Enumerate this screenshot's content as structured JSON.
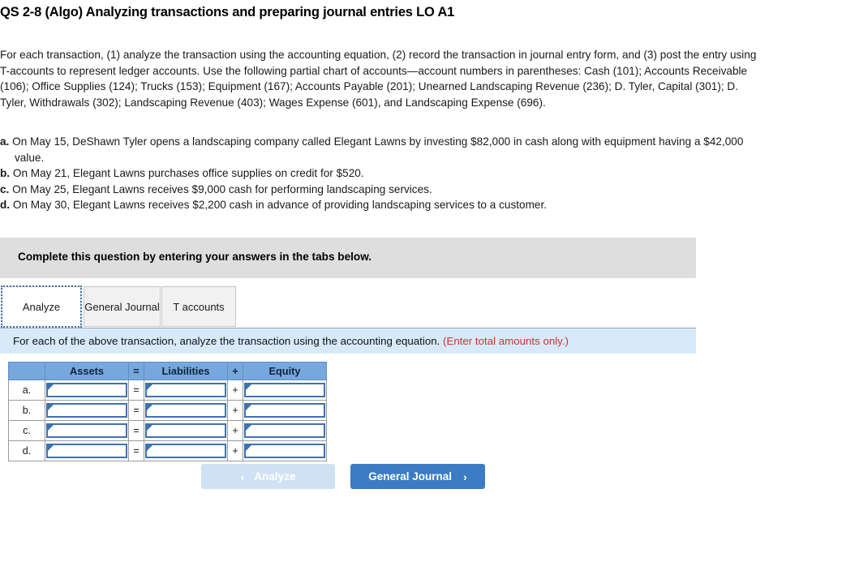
{
  "title": "QS 2-8 (Algo) Analyzing transactions and preparing journal entries LO A1",
  "problem": {
    "body": "For each transaction, (1) analyze the transaction using the accounting equation, (2) record the transaction in journal entry form, and (3) post the entry using T-accounts to represent ledger accounts. Use the following partial chart of accounts—account numbers in parentheses: Cash (101); Accounts Receivable (106); Office Supplies (124); Trucks (153); Equipment (167); Accounts Payable (201); Unearned Landscaping Revenue (236); D. Tyler, Capital (301); D. Tyler, Withdrawals (302); Landscaping Revenue (403); Wages Expense (601), and Landscaping Expense (696)."
  },
  "transactions": [
    {
      "letter": "a.",
      "text": "On May 15, DeShawn Tyler opens a landscaping company called Elegant Lawns by investing $82,000 in cash along with equipment having a $42,000 value."
    },
    {
      "letter": "b.",
      "text": "On May 21, Elegant Lawns purchases office supplies on credit for $520."
    },
    {
      "letter": "c.",
      "text": "On May 25, Elegant Lawns receives $9,000 cash for performing landscaping services."
    },
    {
      "letter": "d.",
      "text": "On May 30, Elegant Lawns receives $2,200 cash in advance of providing landscaping services to a customer."
    }
  ],
  "banner": {
    "text": "Complete this question by entering your answers in the tabs below."
  },
  "tabs": [
    {
      "label": "Analyze",
      "active": true
    },
    {
      "label": "General Journal",
      "active": false
    },
    {
      "label": "T accounts",
      "active": false
    }
  ],
  "instruction": {
    "text": "For each of the above transaction, analyze the transaction using the accounting equation.",
    "note": "(Enter total amounts only.)"
  },
  "table": {
    "headers": [
      "",
      "Assets",
      "=",
      "Liabilities",
      "+",
      "Equity"
    ],
    "rows": [
      {
        "label": "a.",
        "assets": "",
        "op1": "=",
        "liabilities": "",
        "op2": "+",
        "equity": ""
      },
      {
        "label": "b.",
        "assets": "",
        "op1": "=",
        "liabilities": "",
        "op2": "+",
        "equity": ""
      },
      {
        "label": "c.",
        "assets": "",
        "op1": "=",
        "liabilities": "",
        "op2": "+",
        "equity": ""
      },
      {
        "label": "d.",
        "assets": "",
        "op1": "=",
        "liabilities": "",
        "op2": "+",
        "equity": ""
      }
    ]
  },
  "nav": {
    "prev_label": "Analyze",
    "prev_chevron": "‹",
    "next_label": "General Journal",
    "next_chevron": "›"
  },
  "colors": {
    "header_blue": "#76a7dd",
    "input_border": "#3f72ad",
    "banner_gray": "#dedede",
    "instruction_blue": "#d7eafa",
    "note_red": "#d0312d",
    "btn_active": "#3b7cc4",
    "btn_disabled": "#cfe2f5"
  }
}
